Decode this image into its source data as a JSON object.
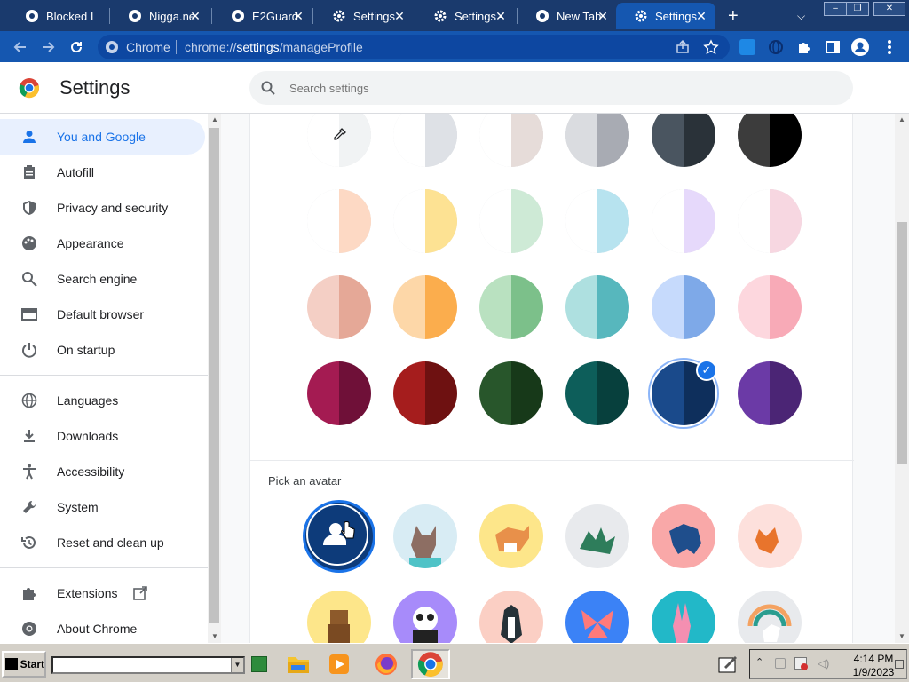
{
  "browser": {
    "tabs": [
      {
        "label": "Blocked I"
      },
      {
        "label": "Nigga.ne"
      },
      {
        "label": "E2Guard"
      },
      {
        "label": "Settings"
      },
      {
        "label": "Settings -"
      },
      {
        "label": "New Tab"
      },
      {
        "label": "Settings"
      }
    ],
    "active_tab_index": 6,
    "new_tab_symbol": "+",
    "window_controls": [
      "–",
      "❐",
      "✕"
    ],
    "omnibox": {
      "site_label": "Chrome",
      "url_prefix": "chrome://",
      "url_highlight": "settings",
      "url_suffix": "/manageProfile"
    }
  },
  "settings": {
    "title": "Settings",
    "search": {
      "placeholder": "Search settings"
    },
    "nav": [
      {
        "label": "You and Google",
        "icon": "person-icon",
        "active": true
      },
      {
        "label": "Autofill",
        "icon": "clipboard-icon"
      },
      {
        "label": "Privacy and security",
        "icon": "shield-icon"
      },
      {
        "label": "Appearance",
        "icon": "palette-icon"
      },
      {
        "label": "Search engine",
        "icon": "search-icon"
      },
      {
        "label": "Default browser",
        "icon": "browser-icon"
      },
      {
        "label": "On startup",
        "icon": "power-icon"
      },
      {
        "label": "Languages",
        "icon": "globe-icon"
      },
      {
        "label": "Downloads",
        "icon": "download-icon"
      },
      {
        "label": "Accessibility",
        "icon": "accessibility-icon"
      },
      {
        "label": "System",
        "icon": "wrench-icon"
      },
      {
        "label": "Reset and clean up",
        "icon": "restore-icon"
      },
      {
        "label": "Extensions",
        "icon": "puzzle-icon"
      },
      {
        "label": "About Chrome",
        "icon": "chrome-icon"
      }
    ],
    "theme_colors": [
      [
        {
          "name": "custom-color",
          "l": "#ffffff",
          "r": "#f1f3f4"
        },
        {
          "name": "default-grey",
          "l": "#ffffff",
          "r": "#dee1e6"
        },
        {
          "name": "warm-grey",
          "l": "#ffffff",
          "r": "#e6dcd9"
        },
        {
          "name": "cool-grey",
          "l": "#dadce0",
          "r": "#a8abb3"
        },
        {
          "name": "slate",
          "l": "#4a5560",
          "r": "#2a3239"
        },
        {
          "name": "black",
          "l": "#3c3c3c",
          "r": "#000000"
        }
      ],
      [
        {
          "name": "peach",
          "l": "#ffffff",
          "r": "#fdd9c4"
        },
        {
          "name": "yellow",
          "l": "#ffffff",
          "r": "#fde293"
        },
        {
          "name": "mint",
          "l": "#ffffff",
          "r": "#ceead6"
        },
        {
          "name": "sky",
          "l": "#ffffff",
          "r": "#b7e3ef"
        },
        {
          "name": "lavender",
          "l": "#ffffff",
          "r": "#e6d9fb"
        },
        {
          "name": "blush",
          "l": "#ffffff",
          "r": "#f7d7e1"
        }
      ],
      [
        {
          "name": "rose",
          "l": "#f4cfc5",
          "r": "#e5a897"
        },
        {
          "name": "orange",
          "l": "#fdd7a8",
          "r": "#fbad4d"
        },
        {
          "name": "green",
          "l": "#b9e1c0",
          "r": "#7cc08a"
        },
        {
          "name": "teal",
          "l": "#aee0e0",
          "r": "#57b7bd"
        },
        {
          "name": "blue",
          "l": "#c6dafc",
          "r": "#7ea9e8"
        },
        {
          "name": "pink",
          "l": "#fdd7de",
          "r": "#f8aab7"
        }
      ],
      [
        {
          "name": "magenta",
          "l": "#a41b52",
          "r": "#6f1038"
        },
        {
          "name": "red",
          "l": "#a51d1d",
          "r": "#6e1111"
        },
        {
          "name": "dark-green",
          "l": "#28562b",
          "r": "#173919"
        },
        {
          "name": "dark-teal",
          "l": "#0d5e5a",
          "r": "#07403d"
        },
        {
          "name": "navy",
          "l": "#1a4a8b",
          "r": "#0e2f5c",
          "selected": true
        },
        {
          "name": "purple",
          "l": "#6b3aa6",
          "r": "#4b2575"
        }
      ]
    ],
    "avatar_section": {
      "title": "Pick an avatar",
      "avatars": [
        {
          "name": "custom-avatar",
          "bg": "#0d3b7a",
          "selected": true
        },
        {
          "name": "cat-avatar",
          "bg": "#d8ecf4"
        },
        {
          "name": "corgi-avatar",
          "bg": "#fde68a"
        },
        {
          "name": "dragon-avatar",
          "bg": "#e8eaed"
        },
        {
          "name": "elephant-avatar",
          "bg": "#f9a8a8"
        },
        {
          "name": "fox-avatar",
          "bg": "#fde0dc"
        },
        {
          "name": "monkey-avatar",
          "bg": "#fde68a"
        },
        {
          "name": "panda-avatar",
          "bg": "#a78bfa"
        },
        {
          "name": "penguin-avatar",
          "bg": "#fbcfc4"
        },
        {
          "name": "butterfly-avatar",
          "bg": "#3b82f6"
        },
        {
          "name": "rabbit-avatar",
          "bg": "#22b8c8"
        },
        {
          "name": "unicorn-avatar",
          "bg": "#e8eaed"
        }
      ]
    }
  },
  "taskbar": {
    "start_label": "Start",
    "time": "4:14 PM",
    "date": "1/9/2023"
  }
}
